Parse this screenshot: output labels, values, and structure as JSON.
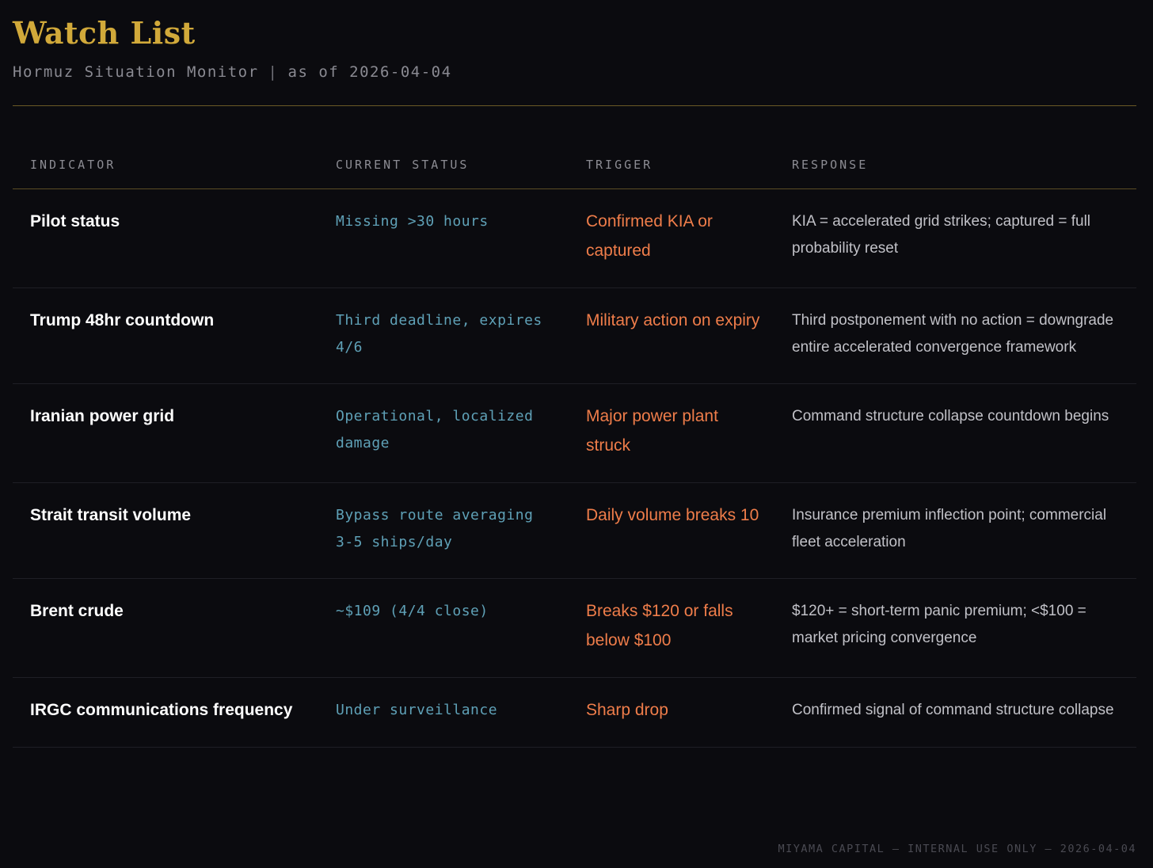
{
  "header": {
    "title": "Watch List",
    "subtitle_left": "Hormuz Situation Monitor",
    "subtitle_separator": "|",
    "subtitle_right": "as of 2026-04-04"
  },
  "table": {
    "columns": [
      "INDICATOR",
      "CURRENT STATUS",
      "TRIGGER",
      "RESPONSE"
    ],
    "rows": [
      {
        "indicator": "Pilot status",
        "status": "Missing >30 hours",
        "trigger": "Confirmed KIA or captured",
        "response": "KIA = accelerated grid strikes; captured = full probability reset"
      },
      {
        "indicator": "Trump 48hr countdown",
        "status": "Third deadline, expires 4/6",
        "trigger": "Military action on expiry",
        "response": "Third postponement with no action = downgrade entire accelerated convergence framework"
      },
      {
        "indicator": "Iranian power grid",
        "status": "Operational, localized damage",
        "trigger": "Major power plant struck",
        "response": "Command structure collapse countdown begins"
      },
      {
        "indicator": "Strait transit volume",
        "status": "Bypass route averaging 3-5 ships/day",
        "trigger": "Daily volume breaks 10",
        "response": "Insurance premium inflection point; commercial fleet acceleration"
      },
      {
        "indicator": "Brent crude",
        "status": "~$109 (4/4 close)",
        "trigger": "Breaks $120 or falls below $100",
        "response": "$120+ = short-term panic premium; <$100 = market pricing convergence"
      },
      {
        "indicator": "IRGC communications frequency",
        "status": "Under surveillance",
        "trigger": "Sharp drop",
        "response": "Confirmed signal of command structure collapse"
      }
    ]
  },
  "footer": {
    "text": "MIYAMA CAPITAL — INTERNAL USE ONLY — 2026-04-04"
  },
  "colors": {
    "background": "#0b0b0f",
    "title": "#d1a93a",
    "status": "#5fa1b7",
    "trigger": "#ef7d4a",
    "response": "#c1c1c7"
  }
}
